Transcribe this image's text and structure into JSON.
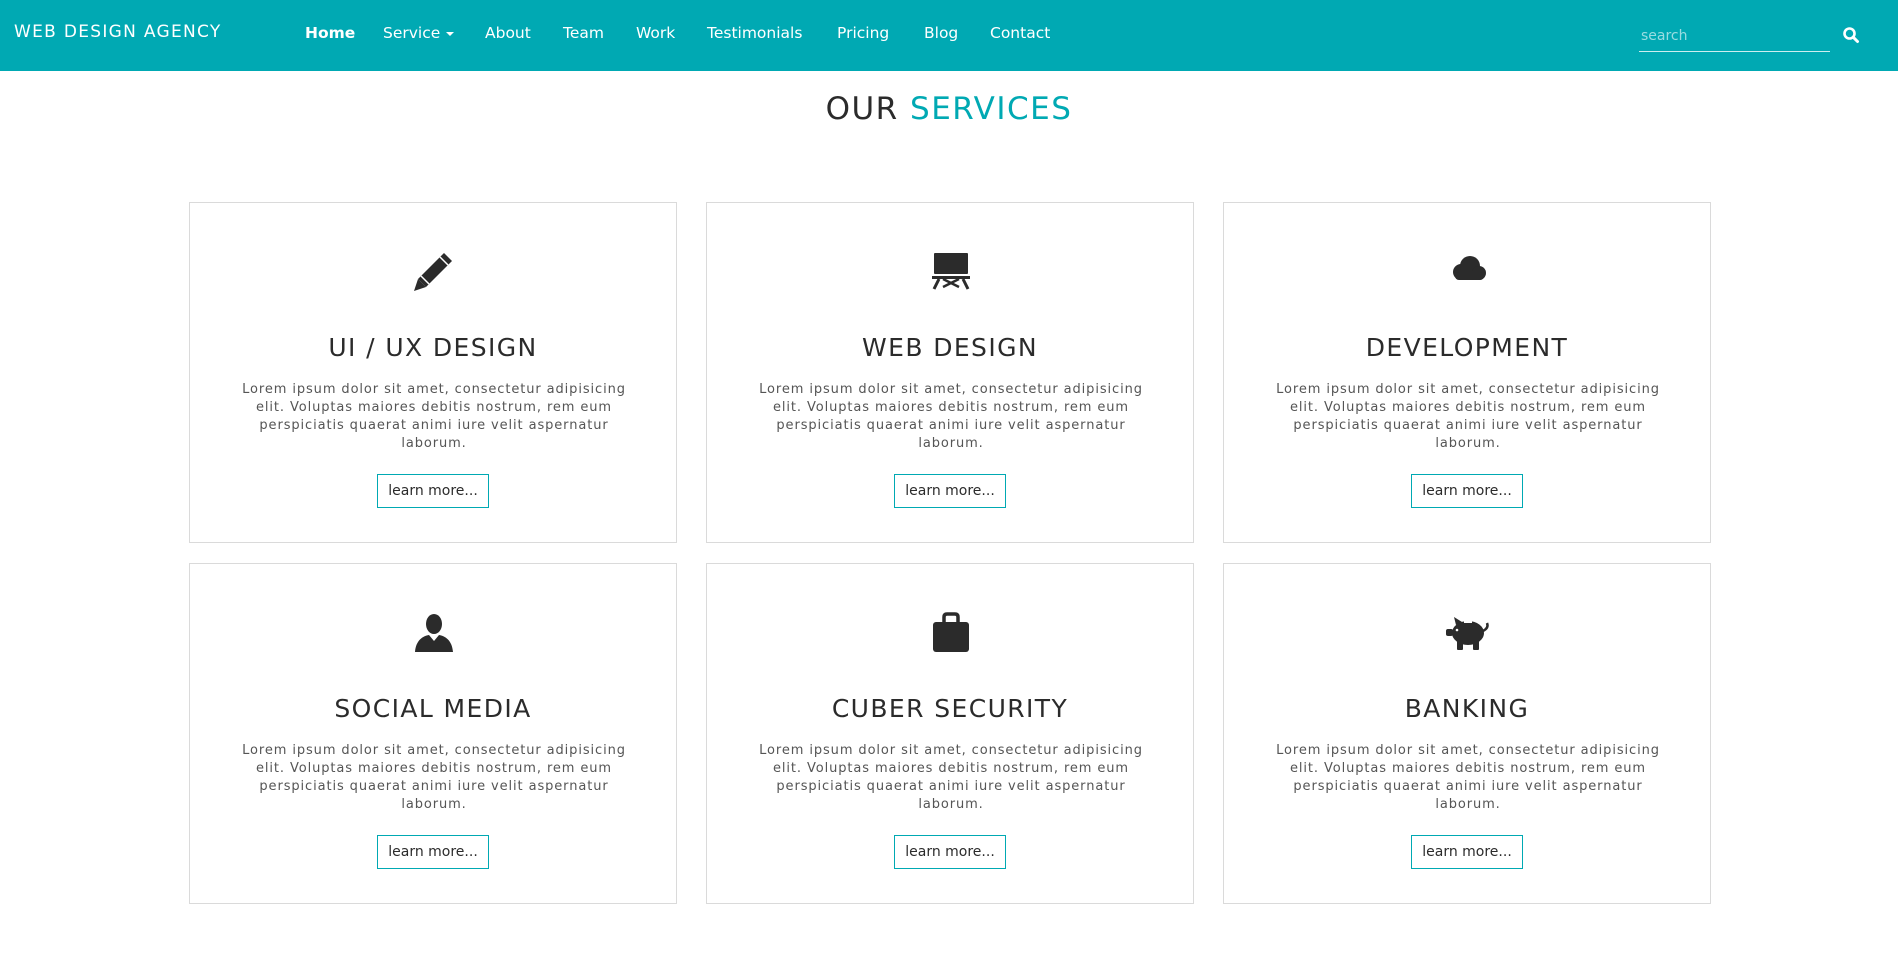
{
  "navbar": {
    "brand": "WEB DESIGN AGENCY",
    "items": [
      {
        "label": "Home",
        "active": true
      },
      {
        "label": "Service",
        "dropdown": true
      },
      {
        "label": "About"
      },
      {
        "label": "Team"
      },
      {
        "label": "Work"
      },
      {
        "label": "Testimonials"
      },
      {
        "label": "Pricing"
      },
      {
        "label": "Blog"
      },
      {
        "label": "Contact"
      }
    ],
    "search_placeholder": "search",
    "search_icon": "search-icon"
  },
  "section": {
    "title_main": "OUR ",
    "title_accent": "SERVICES"
  },
  "services": [
    {
      "title": "UI / UX DESIGN",
      "icon": "pencil-icon",
      "text": "Lorem ipsum dolor sit amet, consectetur adipisicing elit. Voluptas maiores debitis nostrum, rem eum perspiciatis quaerat animi iure velit aspernatur laborum.",
      "button": "learn more..."
    },
    {
      "title": "WEB DESIGN",
      "icon": "blackboard-icon",
      "text": "Lorem ipsum dolor sit amet, consectetur adipisicing elit. Voluptas maiores debitis nostrum, rem eum perspiciatis quaerat animi iure velit aspernatur laborum.",
      "button": "learn more..."
    },
    {
      "title": "DEVELOPMENT",
      "icon": "cloud-icon",
      "text": "Lorem ipsum dolor sit amet, consectetur adipisicing elit. Voluptas maiores debitis nostrum, rem eum perspiciatis quaerat animi iure velit aspernatur laborum.",
      "button": "learn more..."
    },
    {
      "title": "SOCIAL MEDIA",
      "icon": "user-icon",
      "text": "Lorem ipsum dolor sit amet, consectetur adipisicing elit. Voluptas maiores debitis nostrum, rem eum perspiciatis quaerat animi iure velit aspernatur laborum.",
      "button": "learn more..."
    },
    {
      "title": "CUBER SECURITY",
      "icon": "briefcase-icon",
      "text": "Lorem ipsum dolor sit amet, consectetur adipisicing elit. Voluptas maiores debitis nostrum, rem eum perspiciatis quaerat animi iure velit aspernatur laborum.",
      "button": "learn more..."
    },
    {
      "title": "BANKING",
      "icon": "piggy-bank-icon",
      "text": "Lorem ipsum dolor sit amet, consectetur adipisicing elit. Voluptas maiores debitis nostrum, rem eum perspiciatis quaerat animi iure velit aspernatur laborum.",
      "button": "learn more..."
    }
  ],
  "colors": {
    "accent": "#00a9b3",
    "heading": "#2b2b2b",
    "border": "#dadada"
  }
}
